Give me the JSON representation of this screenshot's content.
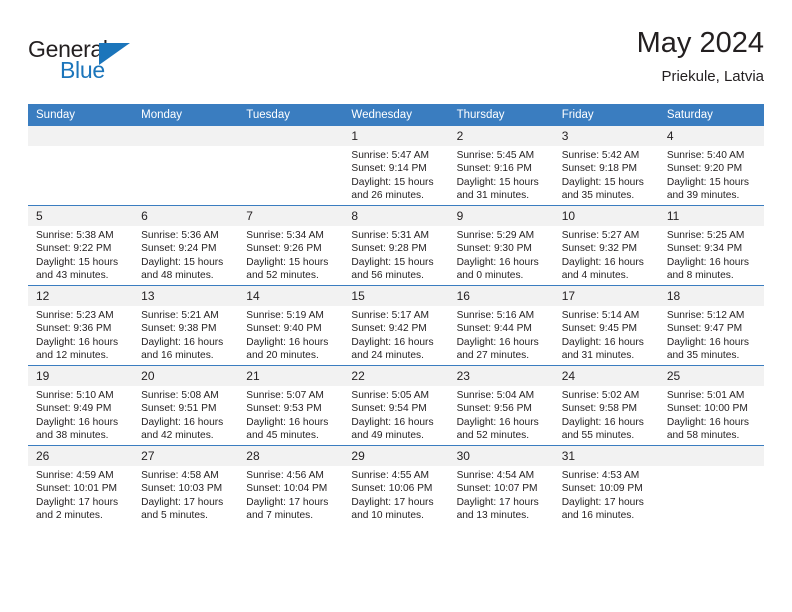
{
  "brand": {
    "name_part1": "General",
    "name_part2": "Blue",
    "triangle_color": "#1b75bb"
  },
  "header": {
    "title": "May 2024",
    "subtitle": "Priekule, Latvia"
  },
  "theme": {
    "header_bg": "#3a7dc0",
    "daynum_bg": "#f2f2f2",
    "text": "#231f20",
    "accent": "#1b75bb"
  },
  "weekday_headers": [
    "Sunday",
    "Monday",
    "Tuesday",
    "Wednesday",
    "Thursday",
    "Friday",
    "Saturday"
  ],
  "weeks": [
    [
      {
        "day": "",
        "sunrise": "",
        "sunset": "",
        "daylight_line1": "",
        "daylight_line2": "",
        "empty": true
      },
      {
        "day": "",
        "sunrise": "",
        "sunset": "",
        "daylight_line1": "",
        "daylight_line2": "",
        "empty": true
      },
      {
        "day": "",
        "sunrise": "",
        "sunset": "",
        "daylight_line1": "",
        "daylight_line2": "",
        "empty": true
      },
      {
        "day": "1",
        "sunrise": "Sunrise: 5:47 AM",
        "sunset": "Sunset: 9:14 PM",
        "daylight_line1": "Daylight: 15 hours",
        "daylight_line2": "and 26 minutes."
      },
      {
        "day": "2",
        "sunrise": "Sunrise: 5:45 AM",
        "sunset": "Sunset: 9:16 PM",
        "daylight_line1": "Daylight: 15 hours",
        "daylight_line2": "and 31 minutes."
      },
      {
        "day": "3",
        "sunrise": "Sunrise: 5:42 AM",
        "sunset": "Sunset: 9:18 PM",
        "daylight_line1": "Daylight: 15 hours",
        "daylight_line2": "and 35 minutes."
      },
      {
        "day": "4",
        "sunrise": "Sunrise: 5:40 AM",
        "sunset": "Sunset: 9:20 PM",
        "daylight_line1": "Daylight: 15 hours",
        "daylight_line2": "and 39 minutes."
      }
    ],
    [
      {
        "day": "5",
        "sunrise": "Sunrise: 5:38 AM",
        "sunset": "Sunset: 9:22 PM",
        "daylight_line1": "Daylight: 15 hours",
        "daylight_line2": "and 43 minutes."
      },
      {
        "day": "6",
        "sunrise": "Sunrise: 5:36 AM",
        "sunset": "Sunset: 9:24 PM",
        "daylight_line1": "Daylight: 15 hours",
        "daylight_line2": "and 48 minutes."
      },
      {
        "day": "7",
        "sunrise": "Sunrise: 5:34 AM",
        "sunset": "Sunset: 9:26 PM",
        "daylight_line1": "Daylight: 15 hours",
        "daylight_line2": "and 52 minutes."
      },
      {
        "day": "8",
        "sunrise": "Sunrise: 5:31 AM",
        "sunset": "Sunset: 9:28 PM",
        "daylight_line1": "Daylight: 15 hours",
        "daylight_line2": "and 56 minutes."
      },
      {
        "day": "9",
        "sunrise": "Sunrise: 5:29 AM",
        "sunset": "Sunset: 9:30 PM",
        "daylight_line1": "Daylight: 16 hours",
        "daylight_line2": "and 0 minutes."
      },
      {
        "day": "10",
        "sunrise": "Sunrise: 5:27 AM",
        "sunset": "Sunset: 9:32 PM",
        "daylight_line1": "Daylight: 16 hours",
        "daylight_line2": "and 4 minutes."
      },
      {
        "day": "11",
        "sunrise": "Sunrise: 5:25 AM",
        "sunset": "Sunset: 9:34 PM",
        "daylight_line1": "Daylight: 16 hours",
        "daylight_line2": "and 8 minutes."
      }
    ],
    [
      {
        "day": "12",
        "sunrise": "Sunrise: 5:23 AM",
        "sunset": "Sunset: 9:36 PM",
        "daylight_line1": "Daylight: 16 hours",
        "daylight_line2": "and 12 minutes."
      },
      {
        "day": "13",
        "sunrise": "Sunrise: 5:21 AM",
        "sunset": "Sunset: 9:38 PM",
        "daylight_line1": "Daylight: 16 hours",
        "daylight_line2": "and 16 minutes."
      },
      {
        "day": "14",
        "sunrise": "Sunrise: 5:19 AM",
        "sunset": "Sunset: 9:40 PM",
        "daylight_line1": "Daylight: 16 hours",
        "daylight_line2": "and 20 minutes."
      },
      {
        "day": "15",
        "sunrise": "Sunrise: 5:17 AM",
        "sunset": "Sunset: 9:42 PM",
        "daylight_line1": "Daylight: 16 hours",
        "daylight_line2": "and 24 minutes."
      },
      {
        "day": "16",
        "sunrise": "Sunrise: 5:16 AM",
        "sunset": "Sunset: 9:44 PM",
        "daylight_line1": "Daylight: 16 hours",
        "daylight_line2": "and 27 minutes."
      },
      {
        "day": "17",
        "sunrise": "Sunrise: 5:14 AM",
        "sunset": "Sunset: 9:45 PM",
        "daylight_line1": "Daylight: 16 hours",
        "daylight_line2": "and 31 minutes."
      },
      {
        "day": "18",
        "sunrise": "Sunrise: 5:12 AM",
        "sunset": "Sunset: 9:47 PM",
        "daylight_line1": "Daylight: 16 hours",
        "daylight_line2": "and 35 minutes."
      }
    ],
    [
      {
        "day": "19",
        "sunrise": "Sunrise: 5:10 AM",
        "sunset": "Sunset: 9:49 PM",
        "daylight_line1": "Daylight: 16 hours",
        "daylight_line2": "and 38 minutes."
      },
      {
        "day": "20",
        "sunrise": "Sunrise: 5:08 AM",
        "sunset": "Sunset: 9:51 PM",
        "daylight_line1": "Daylight: 16 hours",
        "daylight_line2": "and 42 minutes."
      },
      {
        "day": "21",
        "sunrise": "Sunrise: 5:07 AM",
        "sunset": "Sunset: 9:53 PM",
        "daylight_line1": "Daylight: 16 hours",
        "daylight_line2": "and 45 minutes."
      },
      {
        "day": "22",
        "sunrise": "Sunrise: 5:05 AM",
        "sunset": "Sunset: 9:54 PM",
        "daylight_line1": "Daylight: 16 hours",
        "daylight_line2": "and 49 minutes."
      },
      {
        "day": "23",
        "sunrise": "Sunrise: 5:04 AM",
        "sunset": "Sunset: 9:56 PM",
        "daylight_line1": "Daylight: 16 hours",
        "daylight_line2": "and 52 minutes."
      },
      {
        "day": "24",
        "sunrise": "Sunrise: 5:02 AM",
        "sunset": "Sunset: 9:58 PM",
        "daylight_line1": "Daylight: 16 hours",
        "daylight_line2": "and 55 minutes."
      },
      {
        "day": "25",
        "sunrise": "Sunrise: 5:01 AM",
        "sunset": "Sunset: 10:00 PM",
        "daylight_line1": "Daylight: 16 hours",
        "daylight_line2": "and 58 minutes."
      }
    ],
    [
      {
        "day": "26",
        "sunrise": "Sunrise: 4:59 AM",
        "sunset": "Sunset: 10:01 PM",
        "daylight_line1": "Daylight: 17 hours",
        "daylight_line2": "and 2 minutes."
      },
      {
        "day": "27",
        "sunrise": "Sunrise: 4:58 AM",
        "sunset": "Sunset: 10:03 PM",
        "daylight_line1": "Daylight: 17 hours",
        "daylight_line2": "and 5 minutes."
      },
      {
        "day": "28",
        "sunrise": "Sunrise: 4:56 AM",
        "sunset": "Sunset: 10:04 PM",
        "daylight_line1": "Daylight: 17 hours",
        "daylight_line2": "and 7 minutes."
      },
      {
        "day": "29",
        "sunrise": "Sunrise: 4:55 AM",
        "sunset": "Sunset: 10:06 PM",
        "daylight_line1": "Daylight: 17 hours",
        "daylight_line2": "and 10 minutes."
      },
      {
        "day": "30",
        "sunrise": "Sunrise: 4:54 AM",
        "sunset": "Sunset: 10:07 PM",
        "daylight_line1": "Daylight: 17 hours",
        "daylight_line2": "and 13 minutes."
      },
      {
        "day": "31",
        "sunrise": "Sunrise: 4:53 AM",
        "sunset": "Sunset: 10:09 PM",
        "daylight_line1": "Daylight: 17 hours",
        "daylight_line2": "and 16 minutes."
      },
      {
        "day": "",
        "sunrise": "",
        "sunset": "",
        "daylight_line1": "",
        "daylight_line2": "",
        "empty": true
      }
    ]
  ]
}
